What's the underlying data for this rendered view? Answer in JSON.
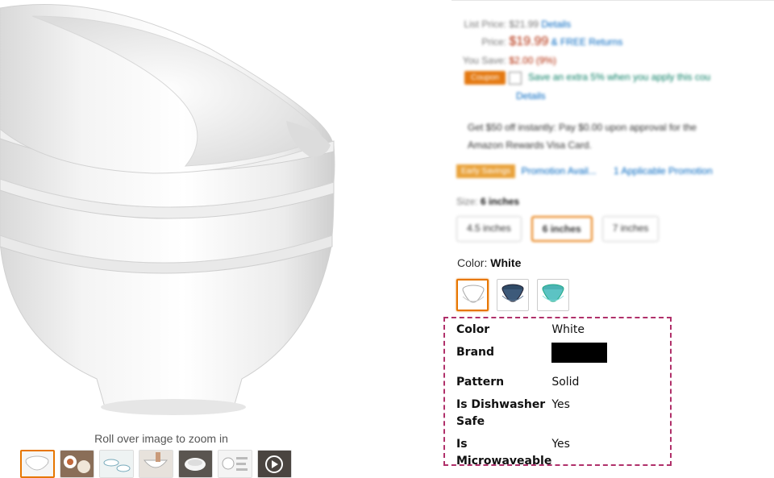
{
  "product_image": {
    "alt": "Stack of four white porcelain bowls",
    "zoom_hint": "Roll over image to zoom in"
  },
  "thumbnails": [
    {
      "name": "thumbnail-bowls-stack",
      "selected": true
    },
    {
      "name": "thumbnail-bowls-food"
    },
    {
      "name": "thumbnail-dimensions"
    },
    {
      "name": "thumbnail-hand-bowl"
    },
    {
      "name": "thumbnail-bowls-table"
    },
    {
      "name": "thumbnail-features"
    },
    {
      "name": "thumbnail-video",
      "icon": "play-icon"
    }
  ],
  "pricing": {
    "list_price_label": "List Price:",
    "list_price": "$21.99",
    "details_link": "Details",
    "price_label": "Price:",
    "price": "$19.99",
    "free_returns": "& FREE Returns",
    "you_save_label": "You Save:",
    "you_save": "$2.00 (9%)",
    "coupon_badge": "Coupon",
    "coupon_text": "Save an extra 5% when you apply this cou",
    "coupon_details": "Details",
    "promo_line1": "Get $50 off instantly: Pay $0.00 upon approval for the",
    "promo_line2": "Amazon Rewards Visa Card.",
    "deal_badge": "Early Savings",
    "promotion_link": "Promotion Avail...",
    "applicable_promotions": "1 Applicable Promotion"
  },
  "size": {
    "label": "Size:",
    "selected": "6 inches",
    "options": [
      "4.5 inches",
      "6 inches",
      "7 inches"
    ]
  },
  "color": {
    "label": "Color:",
    "selected": "White",
    "swatches": [
      {
        "name": "white",
        "hex": "#ffffff",
        "selected": true
      },
      {
        "name": "blue",
        "hex": "#3d5a7a"
      },
      {
        "name": "turquoise",
        "hex": "#5cc3c4"
      }
    ]
  },
  "attributes": [
    {
      "key": "Color",
      "value": "White"
    },
    {
      "key": "Brand",
      "value": "",
      "redacted": true
    },
    {
      "key": "Pattern",
      "value": "Solid"
    },
    {
      "key": "Is Dishwasher Safe",
      "value": "Yes"
    },
    {
      "key": "Is Microwaveable",
      "value": "Yes"
    }
  ],
  "colors": {
    "accent_orange": "#e77600",
    "price_red": "#b12704",
    "highlight_border": "#b0306a"
  }
}
